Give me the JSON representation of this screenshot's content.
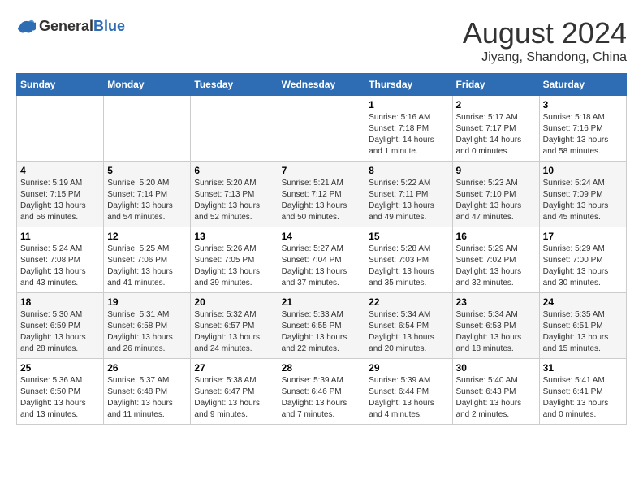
{
  "header": {
    "logo": {
      "text_general": "General",
      "text_blue": "Blue"
    },
    "title": "August 2024",
    "location": "Jiyang, Shandong, China"
  },
  "weekdays": [
    "Sunday",
    "Monday",
    "Tuesday",
    "Wednesday",
    "Thursday",
    "Friday",
    "Saturday"
  ],
  "weeks": [
    {
      "days": [
        {
          "number": "",
          "info": ""
        },
        {
          "number": "",
          "info": ""
        },
        {
          "number": "",
          "info": ""
        },
        {
          "number": "",
          "info": ""
        },
        {
          "number": "1",
          "info": "Sunrise: 5:16 AM\nSunset: 7:18 PM\nDaylight: 14 hours\nand 1 minute."
        },
        {
          "number": "2",
          "info": "Sunrise: 5:17 AM\nSunset: 7:17 PM\nDaylight: 14 hours\nand 0 minutes."
        },
        {
          "number": "3",
          "info": "Sunrise: 5:18 AM\nSunset: 7:16 PM\nDaylight: 13 hours\nand 58 minutes."
        }
      ]
    },
    {
      "days": [
        {
          "number": "4",
          "info": "Sunrise: 5:19 AM\nSunset: 7:15 PM\nDaylight: 13 hours\nand 56 minutes."
        },
        {
          "number": "5",
          "info": "Sunrise: 5:20 AM\nSunset: 7:14 PM\nDaylight: 13 hours\nand 54 minutes."
        },
        {
          "number": "6",
          "info": "Sunrise: 5:20 AM\nSunset: 7:13 PM\nDaylight: 13 hours\nand 52 minutes."
        },
        {
          "number": "7",
          "info": "Sunrise: 5:21 AM\nSunset: 7:12 PM\nDaylight: 13 hours\nand 50 minutes."
        },
        {
          "number": "8",
          "info": "Sunrise: 5:22 AM\nSunset: 7:11 PM\nDaylight: 13 hours\nand 49 minutes."
        },
        {
          "number": "9",
          "info": "Sunrise: 5:23 AM\nSunset: 7:10 PM\nDaylight: 13 hours\nand 47 minutes."
        },
        {
          "number": "10",
          "info": "Sunrise: 5:24 AM\nSunset: 7:09 PM\nDaylight: 13 hours\nand 45 minutes."
        }
      ]
    },
    {
      "days": [
        {
          "number": "11",
          "info": "Sunrise: 5:24 AM\nSunset: 7:08 PM\nDaylight: 13 hours\nand 43 minutes."
        },
        {
          "number": "12",
          "info": "Sunrise: 5:25 AM\nSunset: 7:06 PM\nDaylight: 13 hours\nand 41 minutes."
        },
        {
          "number": "13",
          "info": "Sunrise: 5:26 AM\nSunset: 7:05 PM\nDaylight: 13 hours\nand 39 minutes."
        },
        {
          "number": "14",
          "info": "Sunrise: 5:27 AM\nSunset: 7:04 PM\nDaylight: 13 hours\nand 37 minutes."
        },
        {
          "number": "15",
          "info": "Sunrise: 5:28 AM\nSunset: 7:03 PM\nDaylight: 13 hours\nand 35 minutes."
        },
        {
          "number": "16",
          "info": "Sunrise: 5:29 AM\nSunset: 7:02 PM\nDaylight: 13 hours\nand 32 minutes."
        },
        {
          "number": "17",
          "info": "Sunrise: 5:29 AM\nSunset: 7:00 PM\nDaylight: 13 hours\nand 30 minutes."
        }
      ]
    },
    {
      "days": [
        {
          "number": "18",
          "info": "Sunrise: 5:30 AM\nSunset: 6:59 PM\nDaylight: 13 hours\nand 28 minutes."
        },
        {
          "number": "19",
          "info": "Sunrise: 5:31 AM\nSunset: 6:58 PM\nDaylight: 13 hours\nand 26 minutes."
        },
        {
          "number": "20",
          "info": "Sunrise: 5:32 AM\nSunset: 6:57 PM\nDaylight: 13 hours\nand 24 minutes."
        },
        {
          "number": "21",
          "info": "Sunrise: 5:33 AM\nSunset: 6:55 PM\nDaylight: 13 hours\nand 22 minutes."
        },
        {
          "number": "22",
          "info": "Sunrise: 5:34 AM\nSunset: 6:54 PM\nDaylight: 13 hours\nand 20 minutes."
        },
        {
          "number": "23",
          "info": "Sunrise: 5:34 AM\nSunset: 6:53 PM\nDaylight: 13 hours\nand 18 minutes."
        },
        {
          "number": "24",
          "info": "Sunrise: 5:35 AM\nSunset: 6:51 PM\nDaylight: 13 hours\nand 15 minutes."
        }
      ]
    },
    {
      "days": [
        {
          "number": "25",
          "info": "Sunrise: 5:36 AM\nSunset: 6:50 PM\nDaylight: 13 hours\nand 13 minutes."
        },
        {
          "number": "26",
          "info": "Sunrise: 5:37 AM\nSunset: 6:48 PM\nDaylight: 13 hours\nand 11 minutes."
        },
        {
          "number": "27",
          "info": "Sunrise: 5:38 AM\nSunset: 6:47 PM\nDaylight: 13 hours\nand 9 minutes."
        },
        {
          "number": "28",
          "info": "Sunrise: 5:39 AM\nSunset: 6:46 PM\nDaylight: 13 hours\nand 7 minutes."
        },
        {
          "number": "29",
          "info": "Sunrise: 5:39 AM\nSunset: 6:44 PM\nDaylight: 13 hours\nand 4 minutes."
        },
        {
          "number": "30",
          "info": "Sunrise: 5:40 AM\nSunset: 6:43 PM\nDaylight: 13 hours\nand 2 minutes."
        },
        {
          "number": "31",
          "info": "Sunrise: 5:41 AM\nSunset: 6:41 PM\nDaylight: 13 hours\nand 0 minutes."
        }
      ]
    }
  ]
}
